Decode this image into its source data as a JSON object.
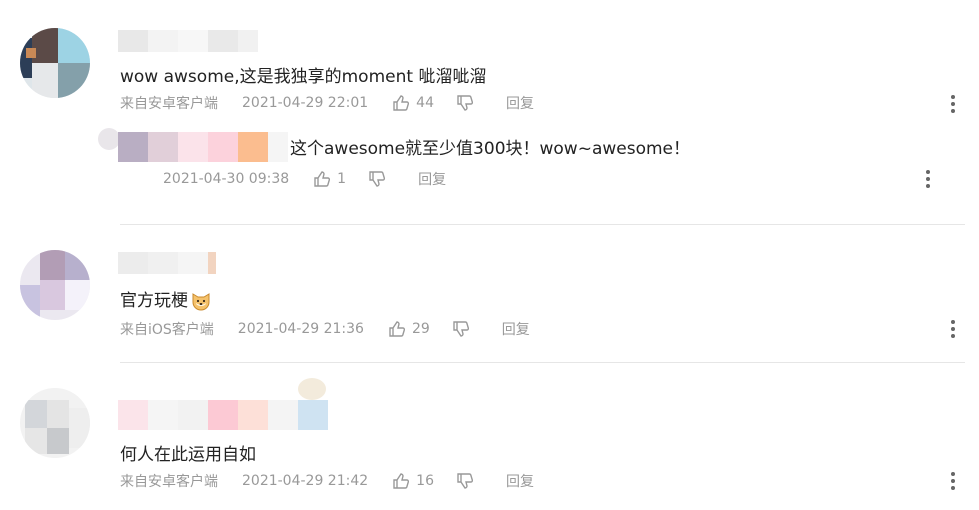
{
  "comments": [
    {
      "text": "wow awsome,这是我独享的moment 呲溜呲溜",
      "source": "来自安卓客户端",
      "time": "2021-04-29 22:01",
      "likes": "44",
      "reply_label": "回复"
    },
    {
      "text": "官方玩梗",
      "emoji": "dog-emoji",
      "source": "来自iOS客户端",
      "time": "2021-04-29 21:36",
      "likes": "29",
      "reply_label": "回复"
    },
    {
      "text": "何人在此运用自如",
      "source": "来自安卓客户端",
      "time": "2021-04-29 21:42",
      "likes": "16",
      "reply_label": "回复"
    }
  ],
  "reply": {
    "text": "这个awesome就至少值300块！wow~awesome！",
    "time": "2021-04-30 09:38",
    "likes": "1",
    "reply_label": "回复"
  },
  "icons": {
    "like": "thumbs-up-icon",
    "dislike": "thumbs-down-icon",
    "more": "more-vertical-icon"
  },
  "colors": {
    "meta_text": "#999999",
    "content_text": "#222222",
    "divider": "#e6e6e6",
    "more_dots": "#666666"
  }
}
